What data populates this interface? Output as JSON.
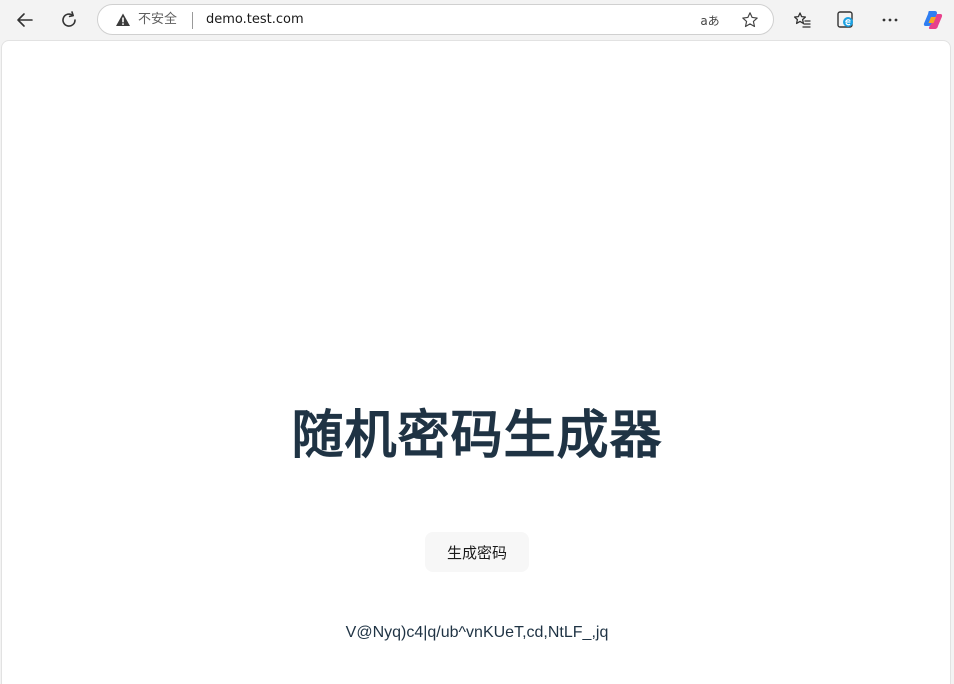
{
  "browser": {
    "security_label": "不安全",
    "url": "demo.test.com",
    "read_aloud_label": "aあ",
    "icons": {
      "back": "back-arrow-icon",
      "refresh": "refresh-icon",
      "warning": "warning-icon",
      "favorite": "star-icon",
      "favorites_list": "favorites-list-icon",
      "collections": "edge-collections-icon",
      "more": "more-dots-icon",
      "copilot": "copilot-icon"
    }
  },
  "page": {
    "title": "随机密码生成器",
    "generate_button": "生成密码",
    "password": "V@Nyq)c4|q/ub^vnKUeT,cd,NtLF_,jq"
  },
  "colors": {
    "title": "#1f3344",
    "button_bg": "#f7f7f7",
    "page_bg": "#ffffff",
    "chrome_bg": "#f3f3f3"
  }
}
